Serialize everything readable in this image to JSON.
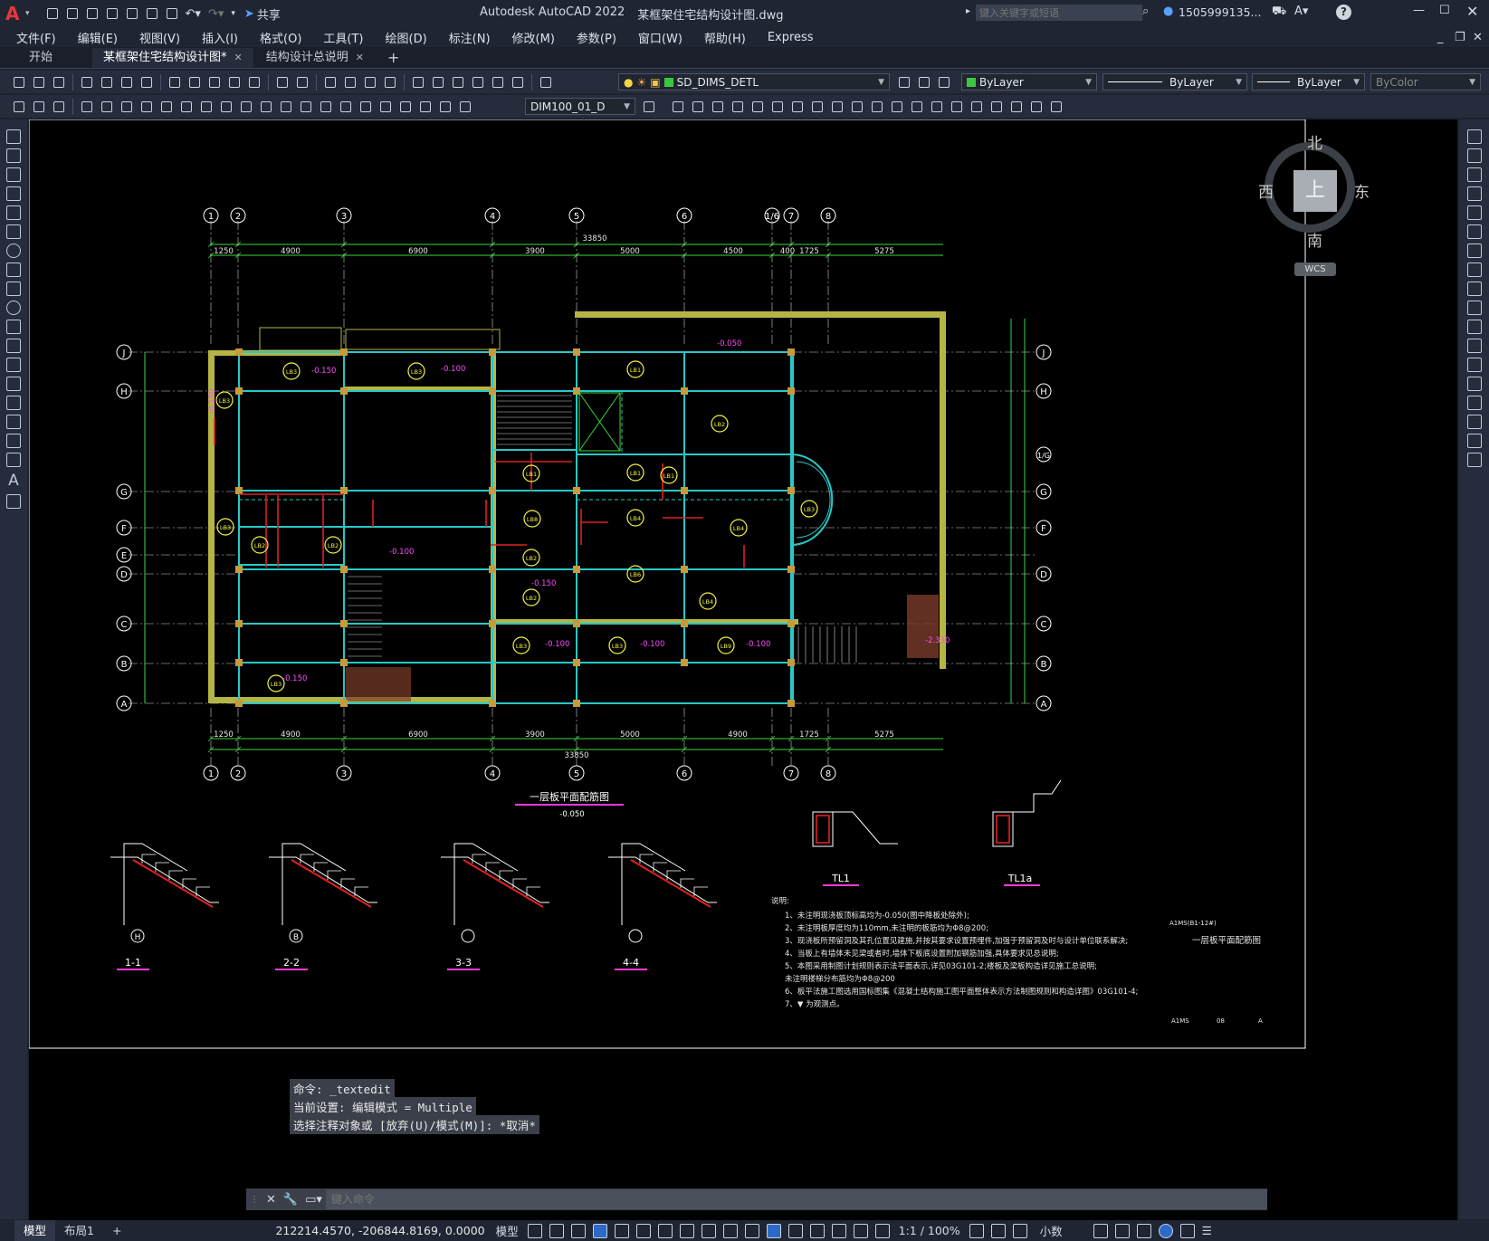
{
  "titlebar": {
    "app_title": "Autodesk AutoCAD 2022",
    "file_title": "某框架住宅结构设计图.dwg",
    "share_label": "共享",
    "search_placeholder": "键入关键字或短语",
    "user": "1505999135...",
    "help": "?"
  },
  "menu": [
    "文件(F)",
    "编辑(E)",
    "视图(V)",
    "插入(I)",
    "格式(O)",
    "工具(T)",
    "绘图(D)",
    "标注(N)",
    "修改(M)",
    "参数(P)",
    "窗口(W)",
    "帮助(H)",
    "Express"
  ],
  "tabs": [
    {
      "label": "开始"
    },
    {
      "label": "某框架住宅结构设计图*",
      "active": true
    },
    {
      "label": "结构设计总说明"
    }
  ],
  "toolbar": {
    "layer": "SD_DIMS_DETL",
    "color": "ByLayer",
    "linetype": "ByLayer",
    "lineweight": "ByLayer",
    "plotstyle": "ByColor",
    "dimstyle": "DIM100_01_D"
  },
  "viewcube": {
    "north": "北",
    "south": "南",
    "east": "东",
    "west": "西",
    "top": "上",
    "wcs": "WCS"
  },
  "drawing": {
    "grid_x": [
      "1",
      "2",
      "3",
      "4",
      "5",
      "6",
      "1/6",
      "7",
      "8"
    ],
    "grid_y": [
      "J",
      "H",
      "G",
      "F",
      "E",
      "D",
      "C",
      "B",
      "A",
      "1/G"
    ],
    "dims_top": [
      "1250",
      "4900",
      "6900",
      "3900",
      "5000",
      "4500",
      "400",
      "1725",
      "5275"
    ],
    "total_width": "33850",
    "dims_bottom": [
      "1250",
      "4900",
      "6900",
      "3900",
      "5000",
      "4900",
      "1725",
      "5275"
    ],
    "plan_title": "一层板平面配筋图",
    "plan_elev": "-0.050",
    "slab_labels": [
      "LB3",
      "LB3",
      "LB5",
      "LB5",
      "LB1",
      "LB8",
      "LB2",
      "LB4",
      "LB7",
      "LB6",
      "LB3",
      "LB2",
      "LB9"
    ],
    "elev_labels": [
      "-0.150",
      "-0.100",
      "-0.050",
      "-0.100",
      "-0.150",
      "-2.330"
    ],
    "sections": [
      {
        "label": "1-1",
        "axis": "H"
      },
      {
        "label": "2-2",
        "axis": "B"
      },
      {
        "label": "3-3",
        "axis": ""
      },
      {
        "label": "4-4",
        "axis": ""
      }
    ],
    "beams": [
      {
        "label": "TL1"
      },
      {
        "label": "TL1a"
      }
    ],
    "notes_title": "说明:",
    "notes": [
      "1、未注明现浇板顶标高均为-0.050(图中降板处除外);",
      "2、未注明板厚度均为110mm,未注明的板筋均为Φ8@200;",
      "3、现浇板所预留洞及其孔位置见建施,并按其要求设置预埋件,加强于预留洞及时与设计单位联系解决;",
      "4、当板上有墙体未见梁或者时,墙体下板底设置附加钢筋加强,具体要求见总说明;",
      "5、本图采用制图计划规则表示法平面表示,详见03G101-2;楼板及梁板构造详见施工总说明;",
      "   未注明楼梯分布筋均为Φ8@200",
      "6、板平法施工图选用国标图集《混凝土结构施工图平面整体表示方法制图规则和构造详图》03G101-4;",
      "7、▼ 为观测点。"
    ],
    "right_label": "一层板平面配筋图",
    "drawing_code": "A1MS(B1-12#)",
    "titleblock": [
      "A1MS",
      "08",
      "A"
    ]
  },
  "command": {
    "history": [
      "命令: _textedit",
      "当前设置: 编辑模式 = Multiple",
      "选择注释对象或 [放弃(U)/模式(M)]: *取消*"
    ],
    "placeholder": "键入命令"
  },
  "status": {
    "tab_model": "模型",
    "tab_layout": "布局1",
    "coords": "212214.4570, -206844.8169, 0.0000",
    "model": "模型",
    "scale": "1:1 / 100%",
    "units": "小数"
  }
}
